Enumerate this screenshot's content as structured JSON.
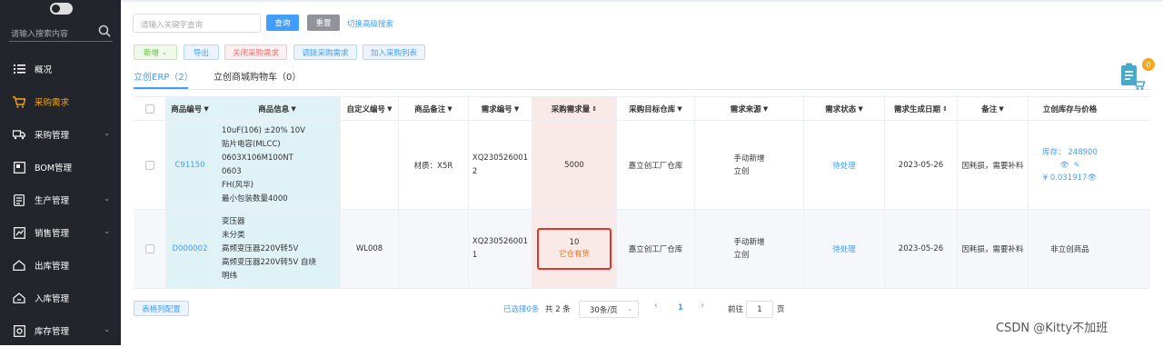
{
  "sidebar": {
    "search_placeholder": "请输入搜索内容",
    "items": [
      {
        "label": "概况",
        "icon": "list-icon",
        "expandable": false,
        "active": false
      },
      {
        "label": "采购需求",
        "icon": "cart-icon",
        "expandable": false,
        "active": true
      },
      {
        "label": "采购管理",
        "icon": "truck-icon",
        "expandable": true,
        "active": false
      },
      {
        "label": "BOM管理",
        "icon": "bom-icon",
        "expandable": false,
        "active": false
      },
      {
        "label": "生产管理",
        "icon": "production-icon",
        "expandable": true,
        "active": false
      },
      {
        "label": "销售管理",
        "icon": "sales-icon",
        "expandable": true,
        "active": false
      },
      {
        "label": "出库管理",
        "icon": "outbound-icon",
        "expandable": false,
        "active": false
      },
      {
        "label": "入库管理",
        "icon": "inbound-icon",
        "expandable": false,
        "active": false
      },
      {
        "label": "库存管理",
        "icon": "inventory-icon",
        "expandable": true,
        "active": false
      }
    ]
  },
  "search": {
    "placeholder": "请输入关键字查询",
    "query_label": "查询",
    "reset_label": "重置",
    "advanced_link": "切换高级搜索"
  },
  "toolbar": {
    "new_label": "新增",
    "export_label": "导出",
    "close_label": "关闭采购需求",
    "transfer_label": "调拨采购需求",
    "add_label": "加入采购列表"
  },
  "tabs": [
    {
      "label": "立创ERP（2）"
    },
    {
      "label": "立创商城购物车（0）"
    }
  ],
  "cart_badge": "0",
  "table": {
    "headers": [
      "商品编号",
      "商品信息",
      "自定义编号",
      "商品备注",
      "需求编号",
      "采购需求量",
      "采购目标仓库",
      "需求来源",
      "需求状态",
      "需求生成日期",
      "备注",
      "立创库存与价格"
    ],
    "rows": [
      {
        "code": "C91150",
        "info": [
          "10uF(106) ±20% 10V",
          "贴片电容(MLCC)",
          "0603X106M100NT",
          "0603",
          "FH(风华)",
          "最小包装数量4000"
        ],
        "custom_code": "",
        "product_note": "材质：X5R",
        "req_no_1": "XQ230526001",
        "req_no_2": "2",
        "qty": "5000",
        "qty_note": "",
        "warehouse": "嘉立创工厂仓库",
        "source_1": "手动新增",
        "source_2": "立创",
        "status": "待处理",
        "date": "2023-05-26",
        "remark": "因耗损，需要补料",
        "stock": "库存： 248900",
        "price": "¥ 0.031917"
      },
      {
        "code": "D000002",
        "info": [
          "变压器",
          "未分类",
          "高频变压器220V转5V",
          "高频变压器220V转5V 自绕",
          "明纬"
        ],
        "custom_code": "WL008",
        "product_note": "",
        "req_no_1": "XQ230526001",
        "req_no_2": "1",
        "qty": "10",
        "qty_note": "它仓有货",
        "warehouse": "嘉立创工厂仓库",
        "source_1": "手动新增",
        "source_2": "立创",
        "status": "待处理",
        "date": "2023-05-26",
        "remark": "因耗损，需要补料",
        "stock_text": "非立创商品"
      }
    ]
  },
  "footer": {
    "config_label": "表格列配置",
    "selected": "已选择0条",
    "total": "共 2 条",
    "page_size": "30条/页",
    "current_page": "1",
    "goto_label": "前往",
    "goto_value": "1",
    "page_unit": "页"
  },
  "watermark": "CSDN @Kitty不加班",
  "colors": {
    "sidebar_bg": "#22252b",
    "accent": "#409eff",
    "active_nav": "#f5a623",
    "danger": "#e0352b"
  }
}
